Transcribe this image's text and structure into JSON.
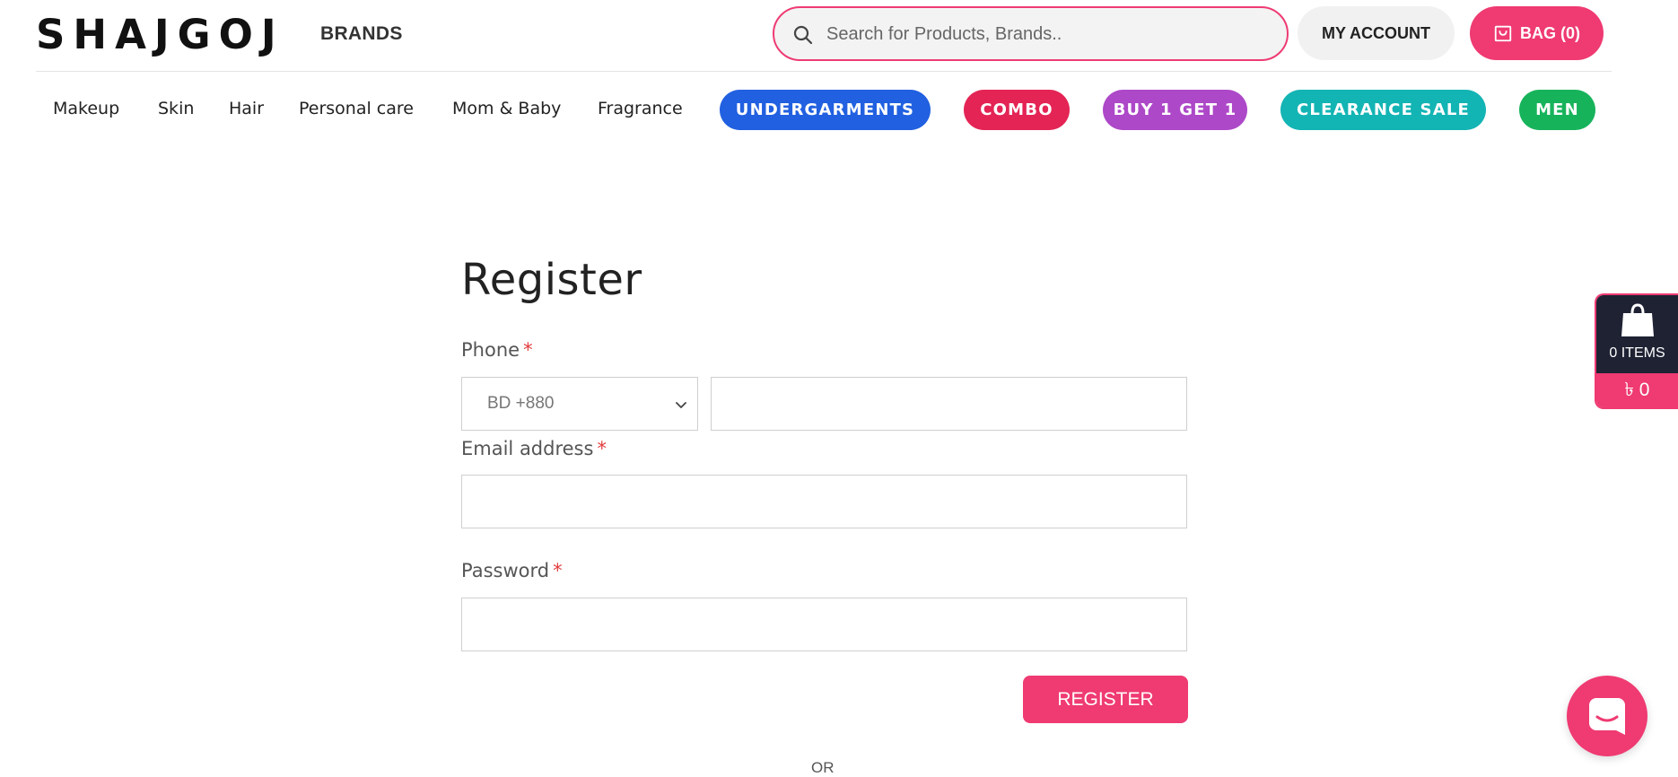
{
  "header": {
    "logo": "SHAJGOJ",
    "brands_label": "BRANDS",
    "search_placeholder": "Search for Products, Brands..",
    "my_account_label": "MY ACCOUNT",
    "bag_label": "BAG (0)"
  },
  "nav": {
    "links": [
      "Makeup",
      "Skin",
      "Hair",
      "Personal care",
      "Mom & Baby",
      "Fragrance"
    ],
    "pills": [
      {
        "label": "UNDERGARMENTS",
        "color": "#2160e0"
      },
      {
        "label": "COMBO",
        "color": "#e42455"
      },
      {
        "label": "BUY 1 GET 1",
        "color": "#ad48c8"
      },
      {
        "label": "CLEARANCE SALE",
        "color": "#13b4b4"
      },
      {
        "label": "MEN",
        "color": "#17b35b"
      }
    ]
  },
  "form": {
    "title": "Register",
    "phone_label": "Phone",
    "required_mark": "*",
    "country_code": "BD +880",
    "phone_value": "",
    "email_label": "Email address",
    "email_value": "",
    "password_label": "Password",
    "password_value": "",
    "register_label": "REGISTER",
    "or_text": "OR"
  },
  "side_cart": {
    "items_label": "0 ITEMS",
    "total": "৳ 0"
  },
  "colors": {
    "accent": "#ef3a72",
    "dark": "#1e2233"
  }
}
